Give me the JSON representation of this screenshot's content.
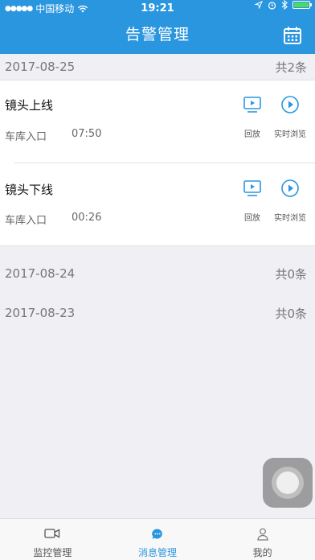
{
  "status_bar": {
    "carrier": "中国移动",
    "time": "19:21"
  },
  "header": {
    "title": "告警管理",
    "calendar_icon": "calendar-icon"
  },
  "groups": [
    {
      "date": "2017-08-25",
      "count": "共2条",
      "items": [
        {
          "name": "镜头上线",
          "location": "车库入口",
          "time": "07:50",
          "playback_label": "回放",
          "live_label": "实时浏览"
        },
        {
          "name": "镜头下线",
          "location": "车库入口",
          "time": "00:26",
          "playback_label": "回放",
          "live_label": "实时浏览"
        }
      ]
    },
    {
      "date": "2017-08-24",
      "count": "共0条",
      "items": []
    },
    {
      "date": "2017-08-23",
      "count": "共0条",
      "items": []
    }
  ],
  "tabbar": {
    "tabs": [
      {
        "label": "监控管理",
        "icon": "camera-icon"
      },
      {
        "label": "消息管理",
        "icon": "message-icon",
        "active": true
      },
      {
        "label": "我的",
        "icon": "user-icon"
      }
    ]
  },
  "colors": {
    "accent": "#2a96e0",
    "background": "#efeff4"
  }
}
